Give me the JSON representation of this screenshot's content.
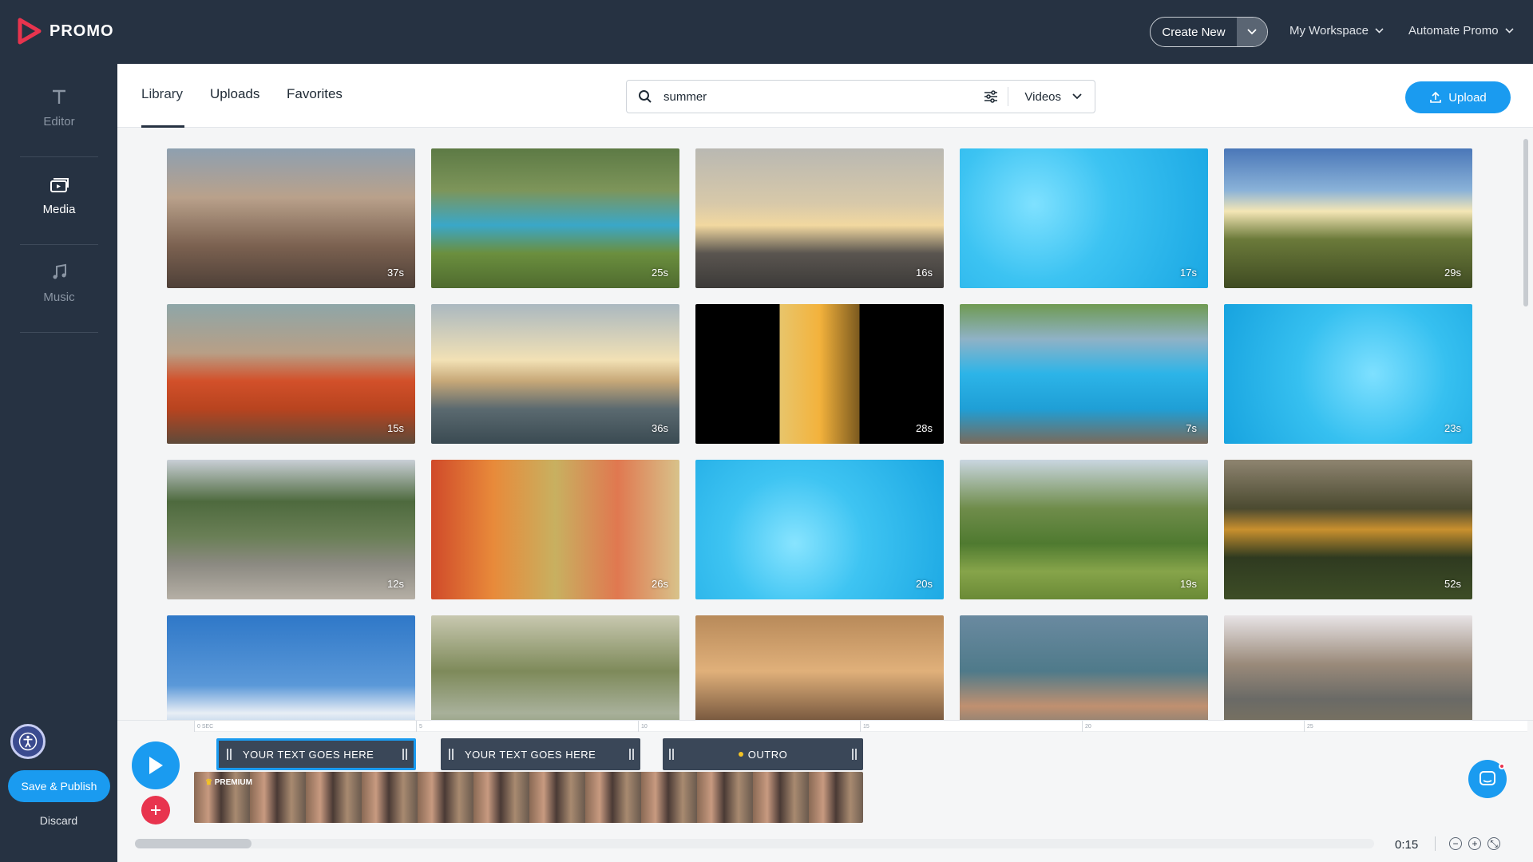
{
  "app": {
    "name": "PROMO"
  },
  "topbar": {
    "create_new": "Create New",
    "workspace": "My Workspace",
    "automate": "Automate Promo"
  },
  "sidebar": {
    "items": [
      {
        "label": "Editor",
        "icon": "text-t-icon"
      },
      {
        "label": "Media",
        "icon": "media-stack-icon"
      },
      {
        "label": "Music",
        "icon": "music-note-icon"
      }
    ],
    "save_publish": "Save & Publish",
    "discard": "Discard"
  },
  "library": {
    "tabs": [
      "Library",
      "Uploads",
      "Favorites"
    ],
    "active_tab": "Library",
    "search_value": "summer",
    "type_filter": "Videos",
    "upload_label": "Upload"
  },
  "thumbnails": [
    {
      "duration": "37s",
      "scene": "festival-crowd"
    },
    {
      "duration": "25s",
      "scene": "backyard-pool-kids"
    },
    {
      "duration": "16s",
      "scene": "boat-sunset"
    },
    {
      "duration": "17s",
      "scene": "pool-water"
    },
    {
      "duration": "29s",
      "scene": "meadow-sun"
    },
    {
      "duration": "15s",
      "scene": "orange-car"
    },
    {
      "duration": "36s",
      "scene": "sea-sunset"
    },
    {
      "duration": "28s",
      "scene": "sunflower-sunset"
    },
    {
      "duration": "7s",
      "scene": "pool-party"
    },
    {
      "duration": "23s",
      "scene": "pool-swimmers"
    },
    {
      "duration": "12s",
      "scene": "lake-kayaks"
    },
    {
      "duration": "26s",
      "scene": "colorful-houses"
    },
    {
      "duration": "20s",
      "scene": "pool-water"
    },
    {
      "duration": "19s",
      "scene": "garden-pool"
    },
    {
      "duration": "52s",
      "scene": "river-sunset"
    },
    {
      "duration": "",
      "scene": "blue-sky"
    },
    {
      "duration": "",
      "scene": "girl-splash"
    },
    {
      "duration": "",
      "scene": "festival-dance"
    },
    {
      "duration": "",
      "scene": "woman-splash"
    },
    {
      "duration": "",
      "scene": "house-porch"
    }
  ],
  "timeline": {
    "ruler_ticks": [
      "0 SEC",
      "5",
      "10",
      "15",
      "20",
      "25"
    ],
    "text_clips": [
      "YOUR TEXT GOES HERE",
      "YOUR TEXT GOES HERE",
      "OUTRO"
    ],
    "premium_label": "PREMIUM",
    "timecode": "0:15"
  },
  "colors": {
    "nav_bg": "#263242",
    "accent": "#1a9bf0",
    "add_button": "#e8344e"
  }
}
